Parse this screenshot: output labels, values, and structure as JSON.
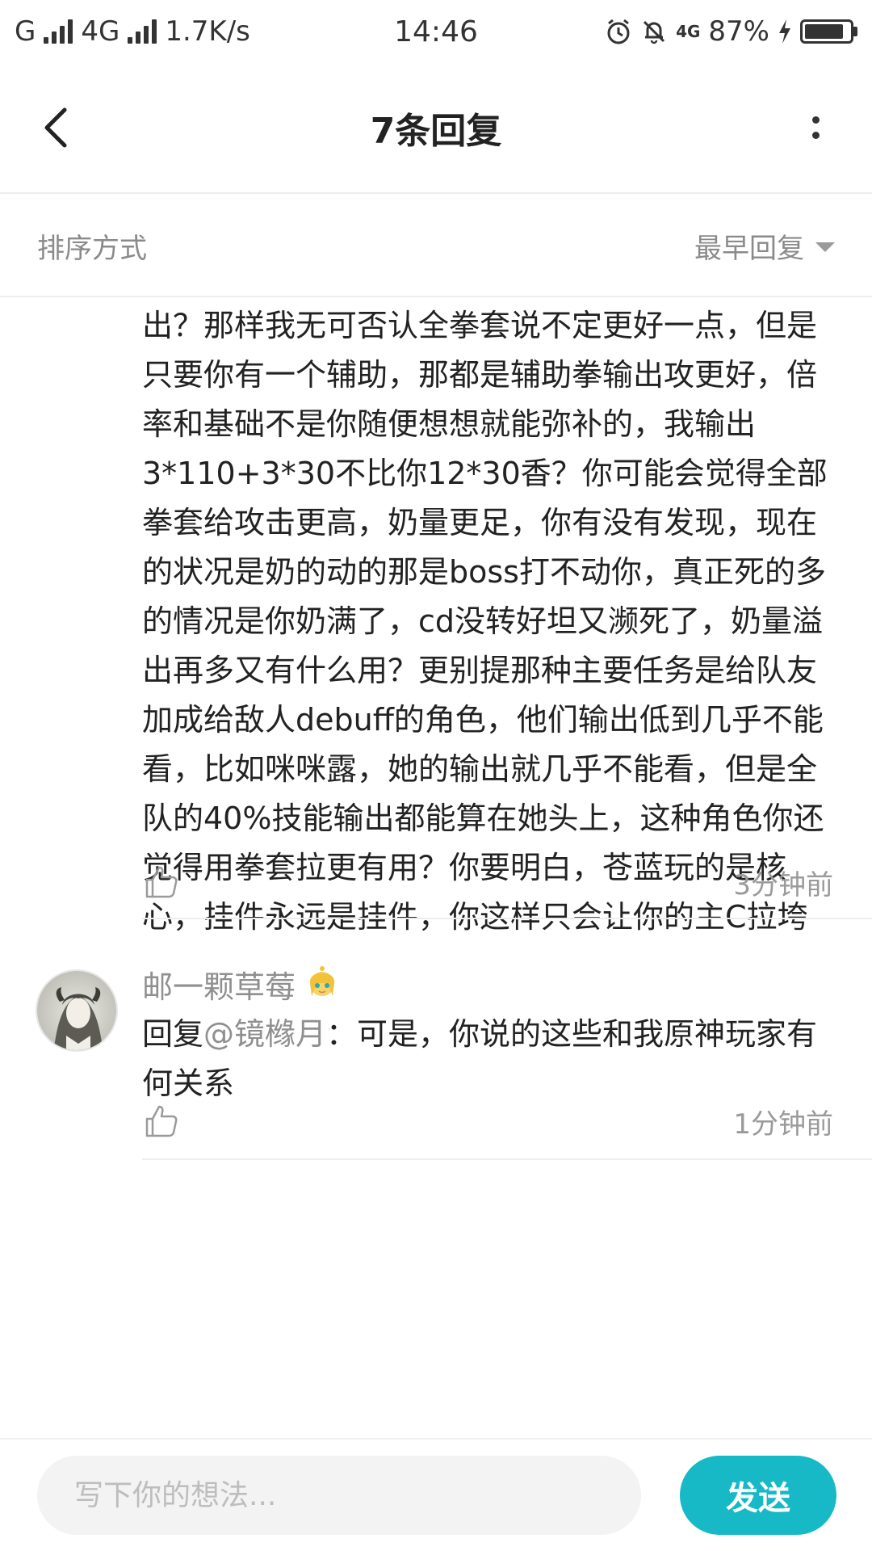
{
  "status_bar": {
    "carrier1": "G",
    "carrier2": "4G",
    "speed": "1.7K/s",
    "time": "14:46",
    "network_badge": "4G",
    "battery_percent": "87%",
    "battery_level": 0.87
  },
  "header": {
    "title": "7条回复",
    "back_icon": "chevron-left-icon",
    "more_icon": "more-vertical-icon"
  },
  "sort": {
    "label": "排序方式",
    "selected": "最早回复"
  },
  "comments": [
    {
      "text": "出？那样我无可否认全拳套说不定更好一点，但是只要你有一个辅助，那都是辅助拳输出攻更好，倍率和基础不是你随便想想就能弥补的，我输出3*110+3*30不比你12*30香？你可能会觉得全部拳套给攻击更高，奶量更足，你有没有发现，现在的状况是奶的动的那是boss打不动你，真正死的多的情况是你奶满了，cd没转好坦又濒死了，奶量溢出再多又有什么用？更别提那种主要任务是给队友加成给敌人debuff的角色，他们输出低到几乎不能看，比如咪咪露，她的输出就几乎不能看，但是全队的40%技能输出都能算在她头上，这种角色你还觉得用拳套拉更有用？你要明白，苍蓝玩的是核心，挂件永远是挂件，你这样只会让你的主C拉垮",
      "time": "3分钟前"
    },
    {
      "username": "邮一颗草莓",
      "reply_prefix": "回复",
      "mention": "@镜橼月",
      "reply_text": "：可是，你说的这些和我原神玩家有何关系",
      "time": "1分钟前"
    }
  ],
  "composer": {
    "placeholder": "写下你的想法...",
    "send_label": "发送"
  },
  "colors": {
    "accent": "#17b9c7",
    "muted_text": "#9a9a9a",
    "divider": "#ededed"
  }
}
